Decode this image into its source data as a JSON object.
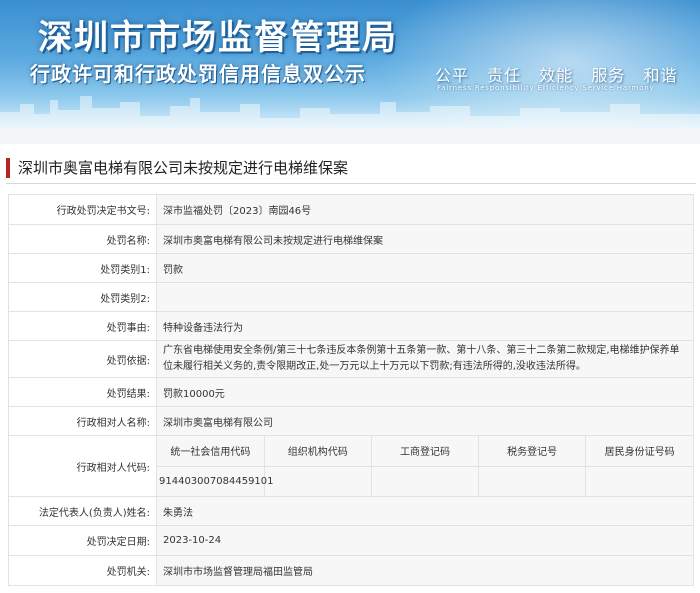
{
  "banner": {
    "title_main": "深圳市市场监督管理局",
    "title_sub": "行政许可和行政处罚信用信息双公示",
    "motto": [
      "公平",
      "责任",
      "效能",
      "服务",
      "和谐"
    ],
    "motto_en": "Fairness  Responsibility  Efficiency  Service  Harmony"
  },
  "page": {
    "title": "深圳市奥富电梯有限公司未按规定进行电梯维保案"
  },
  "fields": [
    {
      "label": "行政处罚决定书文号:",
      "value": "深市监福处罚〔2023〕南园46号"
    },
    {
      "label": "处罚名称:",
      "value": "深圳市奥富电梯有限公司未按规定进行电梯维保案"
    },
    {
      "label": "处罚类别1:",
      "value": "罚款"
    },
    {
      "label": "处罚类别2:",
      "value": ""
    },
    {
      "label": "处罚事由:",
      "value": "特种设备违法行为"
    },
    {
      "label": "处罚依据:",
      "value": "广东省电梯使用安全条例/第三十七条违反本条例第十五条第一款、第十八条、第三十二条第二款规定,电梯维护保养单位未履行相关义务的,责令限期改正,处一万元以上十万元以下罚款;有违法所得的,没收违法所得。"
    },
    {
      "label": "处罚结果:",
      "value": "罚款10000元"
    },
    {
      "label": "行政相对人名称:",
      "value": "深圳市奥富电梯有限公司"
    }
  ],
  "codes": {
    "label": "行政相对人代码:",
    "headers": [
      "统一社会信用代码",
      "组织机构代码",
      "工商登记码",
      "税务登记号",
      "居民身份证号码"
    ],
    "values": [
      "914403007084459101",
      "",
      "",
      "",
      ""
    ]
  },
  "fields_after": [
    {
      "label": "法定代表人(负责人)姓名:",
      "value": "朱勇法"
    },
    {
      "label": "处罚决定日期:",
      "value": "2023-10-24"
    },
    {
      "label": "处罚机关:",
      "value": "深圳市市场监督管理局福田监管局"
    }
  ],
  "colors": {
    "banner_top": "#3a8fd0",
    "accent_bar": "#b32623",
    "value_bg": "#f7f7f7",
    "border": "#e2e2e2"
  }
}
